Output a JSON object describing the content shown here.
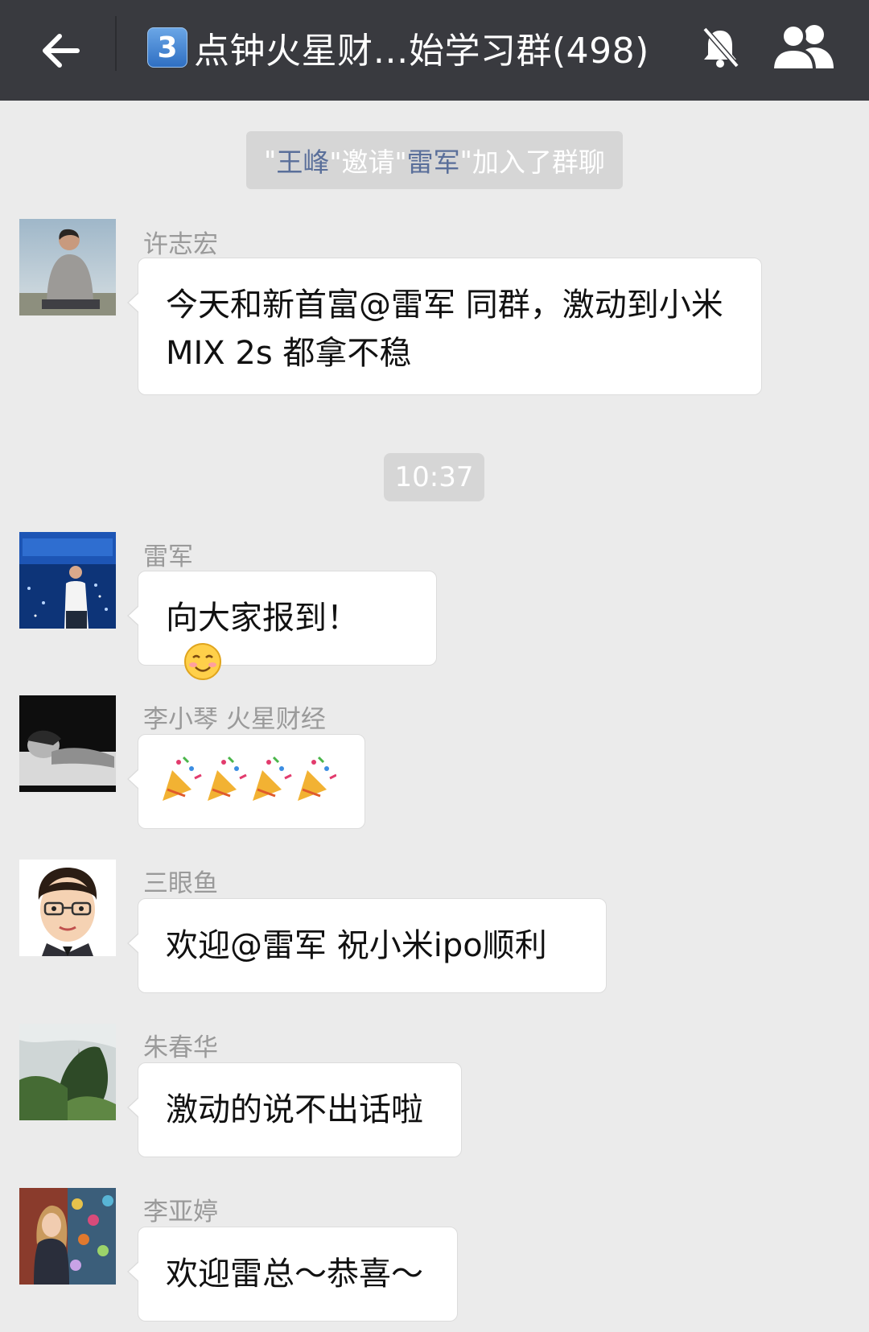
{
  "header": {
    "badge_number": "3",
    "title": "点钟火星财…始学习群(498)"
  },
  "system_message": {
    "quote_open": "\"",
    "inviter": "王峰",
    "quote_mid1": "\"邀请\"",
    "invitee": "雷军",
    "quote_mid2": "\"",
    "action": "加入了群聊"
  },
  "time_divider": "10:37",
  "messages": [
    {
      "sender": "许志宏",
      "text": "今天和新首富@雷军 同群，激动到小米MIX 2s 都拿不稳"
    },
    {
      "sender": "雷军",
      "text": "向大家报到！"
    },
    {
      "sender": "李小琴 火星财经",
      "text": ""
    },
    {
      "sender": "三眼鱼",
      "text": "欢迎@雷军  祝小米ipo顺利"
    },
    {
      "sender": "朱春华",
      "text": "激动的说不出话啦"
    },
    {
      "sender": "李亚婷",
      "text": "欢迎雷总～恭喜～"
    }
  ],
  "colors": {
    "header_bg": "#393a3f",
    "chat_bg": "#ebebeb",
    "bubble_bg": "#ffffff",
    "system_pill_bg": "#d6d6d6",
    "name_link": "#5a6f9a"
  },
  "icons": {
    "back": "arrow-left-icon",
    "mute": "bell-off-icon",
    "members": "group-members-icon",
    "smile": "smiling-face-emoji",
    "party": "party-popper-emoji"
  }
}
